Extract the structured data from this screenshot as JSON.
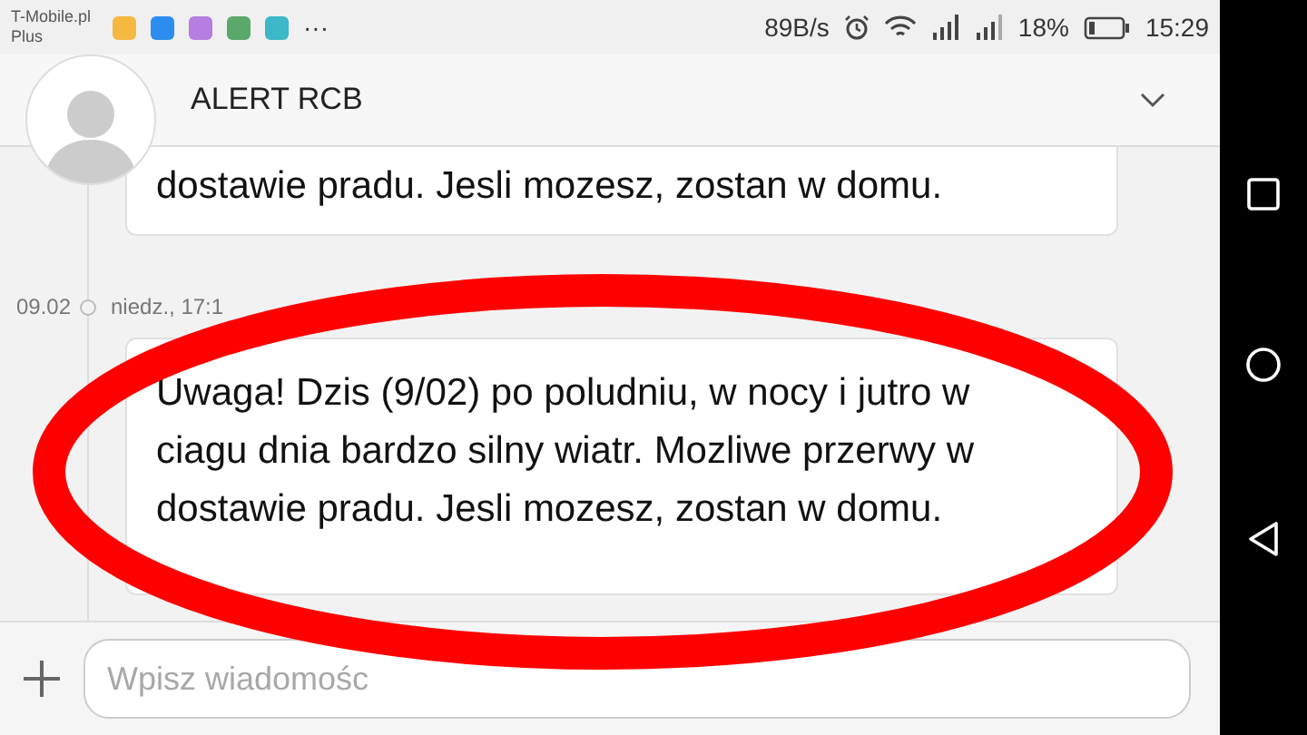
{
  "status_bar": {
    "carrier": "T-Mobile.pl",
    "carrier_line2": "Plus",
    "notification_icons": [
      {
        "color": "#f5b841"
      },
      {
        "color": "#2d8cf0"
      },
      {
        "color": "#b57ee0"
      },
      {
        "color": "#5aa86a"
      },
      {
        "color": "#3cb8c8"
      }
    ],
    "more": "···",
    "speed": "89B/s",
    "battery_percent": "18%",
    "time": "15:29"
  },
  "header": {
    "title": "ALERT RCB"
  },
  "messages": [
    {
      "kind": "partial",
      "text": "dostawie pradu. Jesli mozesz, zostan w domu."
    },
    {
      "kind": "dated",
      "date": "09.02",
      "time": "niedz., 17:1",
      "text": "Uwaga! Dzis (9/02) po poludniu, w nocy i jutro w ciagu dnia bardzo silny wiatr. Mozliwe przerwy w dostawie pradu. Jesli mozesz, zostan w domu."
    }
  ],
  "composer": {
    "placeholder": "Wpisz wiadomośc"
  }
}
